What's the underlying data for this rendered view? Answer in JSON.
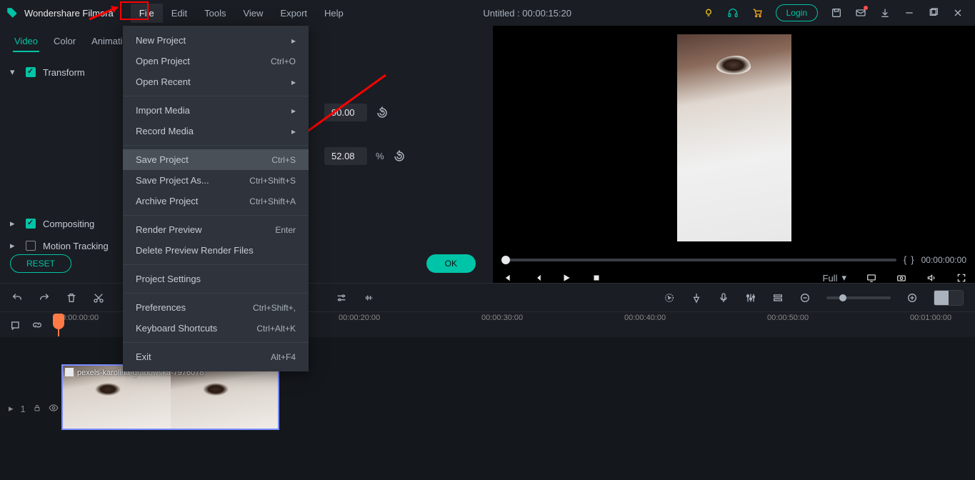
{
  "app_title": "Wondershare Filmora",
  "menubar": [
    "File",
    "Edit",
    "Tools",
    "View",
    "Export",
    "Help"
  ],
  "document_title": "Untitled : 00:00:15:20",
  "login_label": "Login",
  "tabs": [
    "Video",
    "Color",
    "Animation"
  ],
  "transform": {
    "label": "Transform"
  },
  "rotate_val": "90.00",
  "scale_val": "52.08",
  "scale_unit": "%",
  "compositing": {
    "label": "Compositing"
  },
  "motion_tracking": {
    "label": "Motion Tracking"
  },
  "reset_label": "RESET",
  "ok_label": "OK",
  "preview_fit": "Full",
  "timecode_current": "00:00:00:00",
  "ruler": {
    "start": "00:00:00:00",
    "labels": [
      "00:00:20:00",
      "00:00:30:00",
      "00:00:40:00",
      "00:00:50:00",
      "00:01:00:00"
    ]
  },
  "track_num": "1",
  "clip_name": "pexels-karolina-grabowska-7976078",
  "file_menu": [
    {
      "label": "New Project",
      "sub": true
    },
    {
      "label": "Open Project",
      "shortcut": "Ctrl+O"
    },
    {
      "label": "Open Recent",
      "sub": true
    },
    {
      "sep": true
    },
    {
      "label": "Import Media",
      "sub": true
    },
    {
      "label": "Record Media",
      "sub": true
    },
    {
      "sep": true
    },
    {
      "label": "Save Project",
      "shortcut": "Ctrl+S",
      "hl": true
    },
    {
      "label": "Save Project As...",
      "shortcut": "Ctrl+Shift+S"
    },
    {
      "label": "Archive Project",
      "shortcut": "Ctrl+Shift+A"
    },
    {
      "sep": true
    },
    {
      "label": "Render Preview",
      "shortcut": "Enter"
    },
    {
      "label": "Delete Preview Render Files"
    },
    {
      "sep": true
    },
    {
      "label": "Project Settings"
    },
    {
      "sep": true
    },
    {
      "label": "Preferences",
      "shortcut": "Ctrl+Shift+,"
    },
    {
      "label": "Keyboard Shortcuts",
      "shortcut": "Ctrl+Alt+K"
    },
    {
      "sep": true
    },
    {
      "label": "Exit",
      "shortcut": "Alt+F4"
    }
  ]
}
